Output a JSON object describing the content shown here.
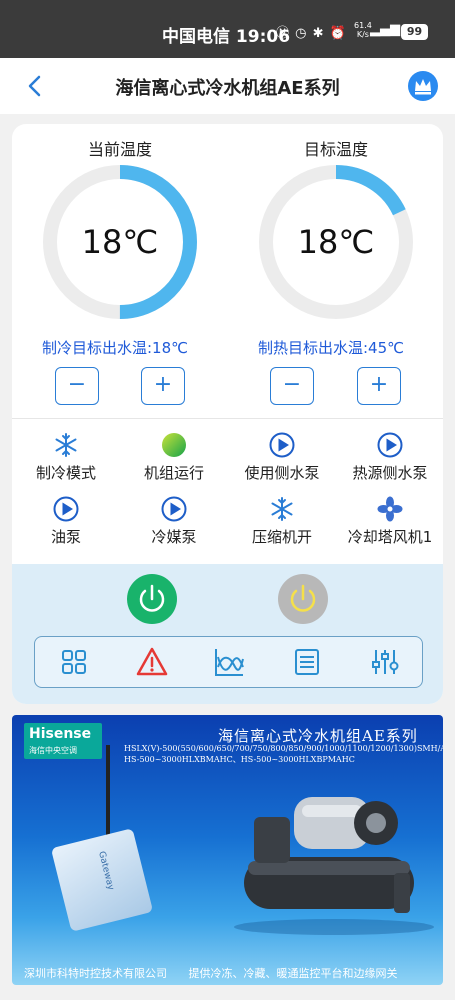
{
  "status_bar": {
    "carrier_time": "中国电信 19:06",
    "net_speed_value": "61.4",
    "net_speed_unit": "K/s",
    "battery": "99"
  },
  "header": {
    "title": "海信离心式冷水机组AE系列"
  },
  "gauges": {
    "current": {
      "label": "当前温度",
      "value": "18℃",
      "fill_fraction": 0.5
    },
    "target": {
      "label": "目标温度",
      "value": "18℃",
      "fill_fraction": 0.18
    }
  },
  "setpoints": {
    "cooling_label": "制冷目标出水温:18℃",
    "heating_label": "制热目标出水温:45℃",
    "minus": "−",
    "plus": "+"
  },
  "status_items": [
    {
      "label": "制冷模式",
      "icon": "snowflake-icon"
    },
    {
      "label": "机组运行",
      "icon": "green-dot-icon"
    },
    {
      "label": "使用侧水泵",
      "icon": "play-icon"
    },
    {
      "label": "热源侧水泵",
      "icon": "play-icon"
    },
    {
      "label": "油泵",
      "icon": "play-icon"
    },
    {
      "label": "冷媒泵",
      "icon": "play-icon"
    },
    {
      "label": "压缩机开",
      "icon": "snowflake-icon"
    },
    {
      "label": "冷却塔风机1",
      "icon": "fan-icon"
    }
  ],
  "colors": {
    "accent_blue": "#2a7dd6",
    "setpoint_text": "#1f5ad8",
    "power_on": "#19b36b",
    "power_off": "#b8b8b8",
    "alarm_red": "#e53935"
  },
  "banner": {
    "brand": "Hisense",
    "brand_sub": "海信中央空调",
    "title": "海信离心式冷水机组AE系列",
    "models": "HSLX(V)-500(550/600/650/700/750/800/850/900/1000/1100/1200/1300)SMH/AE HS-500~3000HLXBMAHC、HS-500~3000HLXBPMAHC",
    "footer_left": "深圳市科特时控技术有限公司",
    "footer_right": "提供冷冻、冷藏、暖通监控平台和边缘网关",
    "gateway_text": "Gateway"
  }
}
